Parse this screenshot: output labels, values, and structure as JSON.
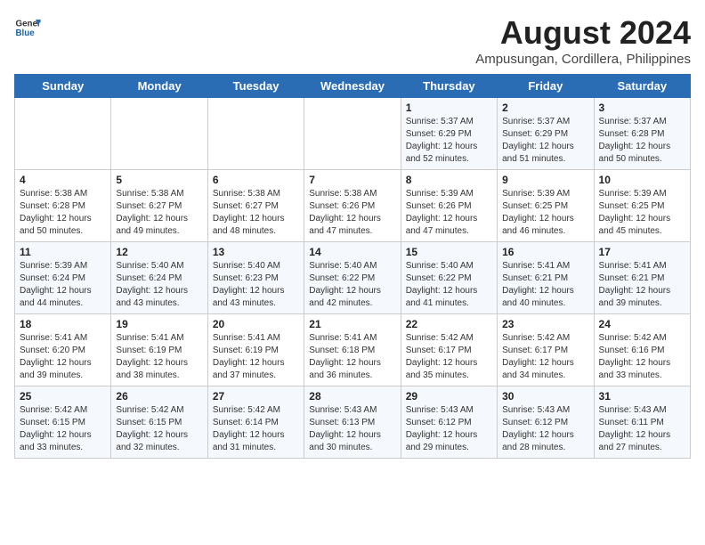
{
  "header": {
    "logo_general": "General",
    "logo_blue": "Blue",
    "title": "August 2024",
    "subtitle": "Ampusungan, Cordillera, Philippines"
  },
  "weekdays": [
    "Sunday",
    "Monday",
    "Tuesday",
    "Wednesday",
    "Thursday",
    "Friday",
    "Saturday"
  ],
  "weeks": [
    [
      {
        "day": "",
        "content": ""
      },
      {
        "day": "",
        "content": ""
      },
      {
        "day": "",
        "content": ""
      },
      {
        "day": "",
        "content": ""
      },
      {
        "day": "1",
        "content": "Sunrise: 5:37 AM\nSunset: 6:29 PM\nDaylight: 12 hours\nand 52 minutes."
      },
      {
        "day": "2",
        "content": "Sunrise: 5:37 AM\nSunset: 6:29 PM\nDaylight: 12 hours\nand 51 minutes."
      },
      {
        "day": "3",
        "content": "Sunrise: 5:37 AM\nSunset: 6:28 PM\nDaylight: 12 hours\nand 50 minutes."
      }
    ],
    [
      {
        "day": "4",
        "content": "Sunrise: 5:38 AM\nSunset: 6:28 PM\nDaylight: 12 hours\nand 50 minutes."
      },
      {
        "day": "5",
        "content": "Sunrise: 5:38 AM\nSunset: 6:27 PM\nDaylight: 12 hours\nand 49 minutes."
      },
      {
        "day": "6",
        "content": "Sunrise: 5:38 AM\nSunset: 6:27 PM\nDaylight: 12 hours\nand 48 minutes."
      },
      {
        "day": "7",
        "content": "Sunrise: 5:38 AM\nSunset: 6:26 PM\nDaylight: 12 hours\nand 47 minutes."
      },
      {
        "day": "8",
        "content": "Sunrise: 5:39 AM\nSunset: 6:26 PM\nDaylight: 12 hours\nand 47 minutes."
      },
      {
        "day": "9",
        "content": "Sunrise: 5:39 AM\nSunset: 6:25 PM\nDaylight: 12 hours\nand 46 minutes."
      },
      {
        "day": "10",
        "content": "Sunrise: 5:39 AM\nSunset: 6:25 PM\nDaylight: 12 hours\nand 45 minutes."
      }
    ],
    [
      {
        "day": "11",
        "content": "Sunrise: 5:39 AM\nSunset: 6:24 PM\nDaylight: 12 hours\nand 44 minutes."
      },
      {
        "day": "12",
        "content": "Sunrise: 5:40 AM\nSunset: 6:24 PM\nDaylight: 12 hours\nand 43 minutes."
      },
      {
        "day": "13",
        "content": "Sunrise: 5:40 AM\nSunset: 6:23 PM\nDaylight: 12 hours\nand 43 minutes."
      },
      {
        "day": "14",
        "content": "Sunrise: 5:40 AM\nSunset: 6:22 PM\nDaylight: 12 hours\nand 42 minutes."
      },
      {
        "day": "15",
        "content": "Sunrise: 5:40 AM\nSunset: 6:22 PM\nDaylight: 12 hours\nand 41 minutes."
      },
      {
        "day": "16",
        "content": "Sunrise: 5:41 AM\nSunset: 6:21 PM\nDaylight: 12 hours\nand 40 minutes."
      },
      {
        "day": "17",
        "content": "Sunrise: 5:41 AM\nSunset: 6:21 PM\nDaylight: 12 hours\nand 39 minutes."
      }
    ],
    [
      {
        "day": "18",
        "content": "Sunrise: 5:41 AM\nSunset: 6:20 PM\nDaylight: 12 hours\nand 39 minutes."
      },
      {
        "day": "19",
        "content": "Sunrise: 5:41 AM\nSunset: 6:19 PM\nDaylight: 12 hours\nand 38 minutes."
      },
      {
        "day": "20",
        "content": "Sunrise: 5:41 AM\nSunset: 6:19 PM\nDaylight: 12 hours\nand 37 minutes."
      },
      {
        "day": "21",
        "content": "Sunrise: 5:41 AM\nSunset: 6:18 PM\nDaylight: 12 hours\nand 36 minutes."
      },
      {
        "day": "22",
        "content": "Sunrise: 5:42 AM\nSunset: 6:17 PM\nDaylight: 12 hours\nand 35 minutes."
      },
      {
        "day": "23",
        "content": "Sunrise: 5:42 AM\nSunset: 6:17 PM\nDaylight: 12 hours\nand 34 minutes."
      },
      {
        "day": "24",
        "content": "Sunrise: 5:42 AM\nSunset: 6:16 PM\nDaylight: 12 hours\nand 33 minutes."
      }
    ],
    [
      {
        "day": "25",
        "content": "Sunrise: 5:42 AM\nSunset: 6:15 PM\nDaylight: 12 hours\nand 33 minutes."
      },
      {
        "day": "26",
        "content": "Sunrise: 5:42 AM\nSunset: 6:15 PM\nDaylight: 12 hours\nand 32 minutes."
      },
      {
        "day": "27",
        "content": "Sunrise: 5:42 AM\nSunset: 6:14 PM\nDaylight: 12 hours\nand 31 minutes."
      },
      {
        "day": "28",
        "content": "Sunrise: 5:43 AM\nSunset: 6:13 PM\nDaylight: 12 hours\nand 30 minutes."
      },
      {
        "day": "29",
        "content": "Sunrise: 5:43 AM\nSunset: 6:12 PM\nDaylight: 12 hours\nand 29 minutes."
      },
      {
        "day": "30",
        "content": "Sunrise: 5:43 AM\nSunset: 6:12 PM\nDaylight: 12 hours\nand 28 minutes."
      },
      {
        "day": "31",
        "content": "Sunrise: 5:43 AM\nSunset: 6:11 PM\nDaylight: 12 hours\nand 27 minutes."
      }
    ]
  ]
}
